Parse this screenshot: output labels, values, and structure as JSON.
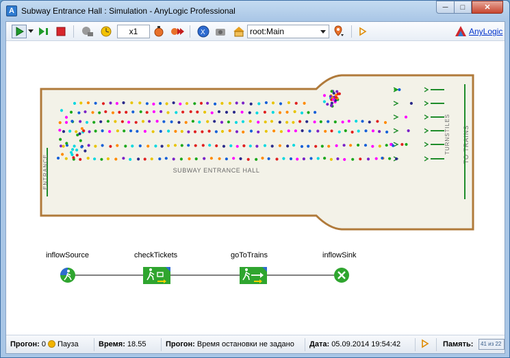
{
  "window": {
    "app_icon": "A",
    "title": "Subway Entrance Hall : Simulation - AnyLogic Professional",
    "min_glyph": "─",
    "max_glyph": "□",
    "close_glyph": "✕"
  },
  "toolbar": {
    "speed": "x1",
    "view": "root:Main",
    "brand_link": "AnyLogic",
    "icons": [
      "run-icon",
      "dropdown-icon",
      "step-icon",
      "stop-icon",
      "slower-icon",
      "clock-icon",
      "faster-icon",
      "max-speed-icon",
      "navigate-icon",
      "camera-icon",
      "home-icon",
      "location-icon",
      "log-icon"
    ]
  },
  "hall": {
    "entrance_label": "ENTRANCE",
    "hall_label": "SUBWAY ENTRANCE HALL",
    "turnstiles_label": "TURNSTILES",
    "trains_label": "TO TRAINS"
  },
  "flowchart": {
    "blocks": [
      {
        "label": "inflowSource",
        "icon": "pedestrian-source-icon"
      },
      {
        "label": "checkTickets",
        "icon": "pedestrian-service-icon"
      },
      {
        "label": "goToTrains",
        "icon": "pedestrian-goto-icon"
      },
      {
        "label": "inflowSink",
        "icon": "pedestrian-sink-icon"
      }
    ]
  },
  "status": {
    "run_label": "Прогон:",
    "run_value": "0",
    "pause_label": "Пауза",
    "time_label": "Время:",
    "time_value": "18.55",
    "run2_label": "Прогон:",
    "run2_value": "Время остановки не задано",
    "date_label": "Дата:",
    "date_value": "05.09.2014 19:54:42",
    "memory_label": "Память:",
    "memory_value": "41 из 22"
  },
  "colors": {
    "hall_fill": "#f3f2e8",
    "hall_border": "#b07a3a",
    "turnstile_green": "#1e8c2a",
    "block_green": "#2fa52f",
    "link": "#0033cc"
  }
}
